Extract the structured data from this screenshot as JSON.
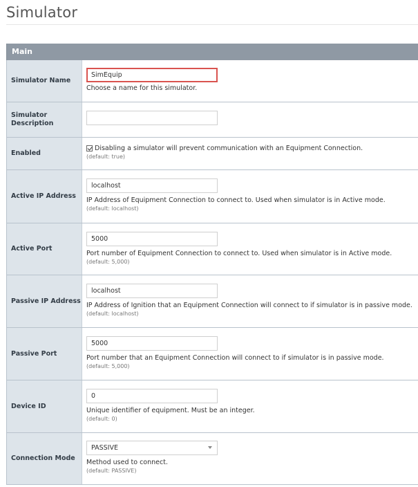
{
  "page": {
    "title": "Simulator"
  },
  "section": {
    "title": "Main"
  },
  "fields": {
    "simulator_name": {
      "label": "Simulator Name",
      "value": "SimEquip",
      "description": "Choose a name for this simulator."
    },
    "simulator_description": {
      "label": "Simulator Description",
      "value": ""
    },
    "enabled": {
      "label": "Enabled",
      "checked": true,
      "description": "Disabling a simulator will prevent communication with an Equipment Connection.",
      "default": "(default: true)"
    },
    "active_ip": {
      "label": "Active IP Address",
      "value": "localhost",
      "description": "IP Address of Equipment Connection to connect to. Used when simulator is in Active mode.",
      "default": "(default: localhost)"
    },
    "active_port": {
      "label": "Active Port",
      "value": "5000",
      "description": "Port number of Equipment Connection to connect to. Used when simulator is in Active mode.",
      "default": "(default: 5,000)"
    },
    "passive_ip": {
      "label": "Passive IP Address",
      "value": "localhost",
      "description": "IP Address of Ignition that an Equipment Connection will connect to if simulator is in passive mode.",
      "default": "(default: localhost)"
    },
    "passive_port": {
      "label": "Passive Port",
      "value": "5000",
      "description": "Port number that an Equipment Connection will connect to if simulator is in passive mode.",
      "default": "(default: 5,000)"
    },
    "device_id": {
      "label": "Device ID",
      "value": "0",
      "description": "Unique identifier of equipment. Must be an integer.",
      "default": "(default: 0)"
    },
    "connection_mode": {
      "label": "Connection Mode",
      "value": "PASSIVE",
      "description": "Method used to connect.",
      "default": "(default: PASSIVE)"
    }
  },
  "colors": {
    "header": "#8f99a4",
    "label_bg": "#dde4ea",
    "highlight": "#d9534f"
  }
}
